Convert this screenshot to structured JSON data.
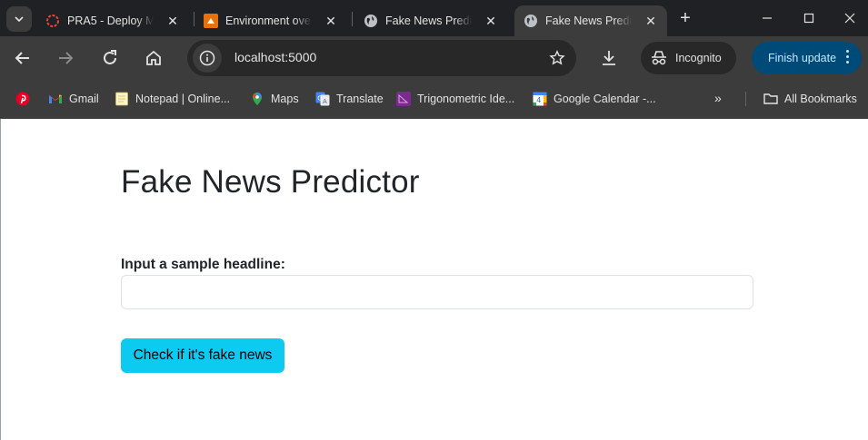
{
  "browser": {
    "tabs": [
      {
        "title": "PRA5 - Deploy M",
        "favicon": "pra5-ring-icon"
      },
      {
        "title": "Environment ove",
        "favicon": "environment-icon"
      },
      {
        "title": "Fake News Predi",
        "favicon": "globe-icon"
      },
      {
        "title": "Fake News Predi",
        "favicon": "globe-icon",
        "active": true
      }
    ],
    "new_tab_label": "+",
    "url": "localhost:5000",
    "incognito_label": "Incognito",
    "finish_update_label": "Finish update",
    "accent_color": "#004a77",
    "bookmarks": [
      {
        "label": "",
        "icon": "pinterest-icon"
      },
      {
        "label": "Gmail",
        "icon": "gmail-icon"
      },
      {
        "label": "Notepad | Online...",
        "icon": "notepad-icon"
      },
      {
        "label": "Maps",
        "icon": "maps-icon"
      },
      {
        "label": "Translate",
        "icon": "translate-icon"
      },
      {
        "label": "Trigonometric Ide...",
        "icon": "trig-icon"
      },
      {
        "label": "Google Calendar -...",
        "icon": "calendar-icon"
      }
    ],
    "more_bookmarks": "»",
    "all_bookmarks_label": "All Bookmarks"
  },
  "page": {
    "title": "Fake News Predictor",
    "input_label": "Input a sample headline:",
    "input_value": "",
    "input_placeholder": "",
    "submit_label": "Check if it's fake news",
    "button_color": "#0dcaf0"
  }
}
